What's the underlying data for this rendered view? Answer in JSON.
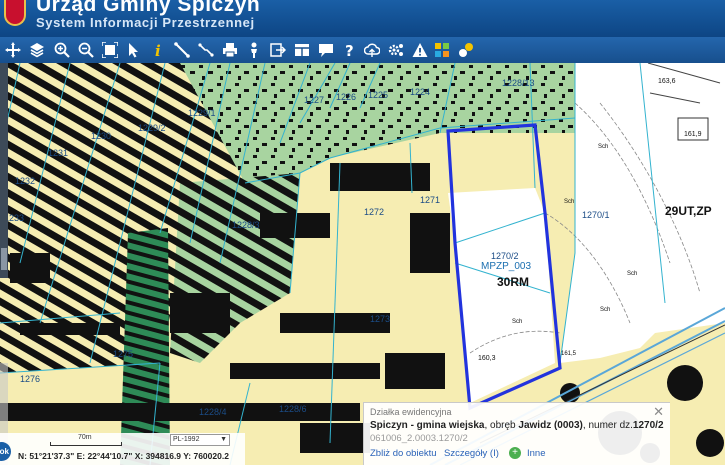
{
  "header": {
    "title": "Urząd Gminy Spiczyn",
    "subtitle": "System Informacji Przestrzennej"
  },
  "toolbar": {
    "tools": [
      {
        "name": "pan-icon",
        "glyph": "✥"
      },
      {
        "name": "layers-icon",
        "glyph": "layers"
      },
      {
        "name": "zoom-in-icon",
        "glyph": "zoom+"
      },
      {
        "name": "zoom-out-icon",
        "glyph": "zoom-"
      },
      {
        "name": "full-extent-icon",
        "glyph": "extent"
      },
      {
        "name": "select-arrow-icon",
        "glyph": "arrow"
      },
      {
        "name": "info-icon",
        "glyph": "i"
      },
      {
        "name": "measure-distance-icon",
        "glyph": "ruler"
      },
      {
        "name": "measure-link-icon",
        "glyph": "link"
      },
      {
        "name": "print-icon",
        "glyph": "print"
      },
      {
        "name": "person-icon",
        "glyph": "person"
      },
      {
        "name": "export-icon",
        "glyph": "export"
      },
      {
        "name": "table-icon",
        "glyph": "table"
      },
      {
        "name": "comment-icon",
        "glyph": "comment"
      },
      {
        "name": "help-icon",
        "glyph": "?"
      },
      {
        "name": "cloud-upload-icon",
        "glyph": "cloud"
      },
      {
        "name": "settings-icon",
        "glyph": "gears"
      },
      {
        "name": "warning-icon",
        "glyph": "warning"
      },
      {
        "name": "color-grid-icon",
        "glyph": "grid"
      },
      {
        "name": "chat-bubbles-icon",
        "glyph": "bubbles"
      }
    ]
  },
  "map": {
    "plot_labels": [
      "1228/13",
      "1224",
      "1227",
      "1226",
      "1225",
      "1229/1",
      "1229/2",
      "1230",
      "1231",
      "1232",
      "1233",
      "1228/3",
      "1271",
      "1272",
      "1273",
      "1275",
      "1276",
      "1228/4",
      "1228/6",
      "1270/2",
      "1270/1"
    ],
    "selected_plot_label": "1270/2",
    "zone_labels": [
      "MPZP_003",
      "30RM",
      "29UT,ZP"
    ],
    "contour_labels": [
      "160,3",
      "161,9",
      "163,6",
      "Sch",
      "Sch",
      "Sch",
      "Sch",
      "Sch",
      "161,5"
    ],
    "colors": {
      "zone_yellow": "#f6edb2",
      "forest_green": "#a8d4a0",
      "dark_green": "#2e8b57",
      "black_pattern": "#111111",
      "plot_border": "#33b3cf",
      "selection": "#2233dd",
      "highway_blue": "#5aa7d8"
    }
  },
  "popup": {
    "heading": "Działka ewidencyjna",
    "municipality": "Spiczyn - gmina wiejska",
    "precinct_text": ", obręb ",
    "precinct": "Jawidz (0003)",
    "number_text": ", numer dz.",
    "plot_number": "1270/2",
    "plot_id": "061006_2.0003.1270/2",
    "links": [
      "Zbliż do obiektu",
      "Szczegóły (I)",
      "Inne"
    ]
  },
  "status": {
    "scale_label": "70m",
    "crs_selected": "PL-1992",
    "coordinates": "N: 51°21'37.3\" E: 22°44'10.7\"  X: 394816.9  Y: 760020.2",
    "ok_label": "ok"
  }
}
